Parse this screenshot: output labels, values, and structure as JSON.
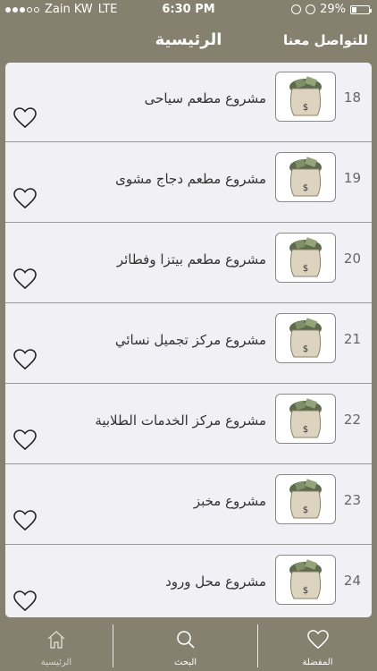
{
  "status_bar": {
    "carrier": "Zain KW",
    "network": "LTE",
    "time": "6:30 PM",
    "battery_text": "29%",
    "battery_level": 0.29,
    "signal_bars_filled": 3,
    "signal_bars_total": 5
  },
  "navbar": {
    "title": "الرئيسية",
    "contact_label": "للتواصل معنا"
  },
  "items": [
    {
      "number": "18",
      "title": "مشروع مطعم سياحى"
    },
    {
      "number": "19",
      "title": "مشروع مطعم دجاج مشوى"
    },
    {
      "number": "20",
      "title": "مشروع مطعم بيتزا وفطائر"
    },
    {
      "number": "21",
      "title": "مشروع مركز تجميل نسائي"
    },
    {
      "number": "22",
      "title": "مشروع مركز الخدمات الطلابية"
    },
    {
      "number": "23",
      "title": "مشروع مخبز"
    },
    {
      "number": "24",
      "title": "مشروع محل ورود"
    }
  ],
  "tabbar": {
    "home_label": "الرئيسية",
    "search_label": "البحث",
    "favorites_label": "المفضلة"
  },
  "colors": {
    "bar_background": "#86806e",
    "list_background": "#f1f0f4",
    "tab_inactive": "#d8d5cc",
    "tab_active": "#ffffff"
  },
  "icons": {
    "row_image": "money-bag-icon",
    "row_action": "heart-outline-icon",
    "tab_home": "home-icon",
    "tab_search": "search-icon",
    "tab_favorites": "heart-icon"
  }
}
